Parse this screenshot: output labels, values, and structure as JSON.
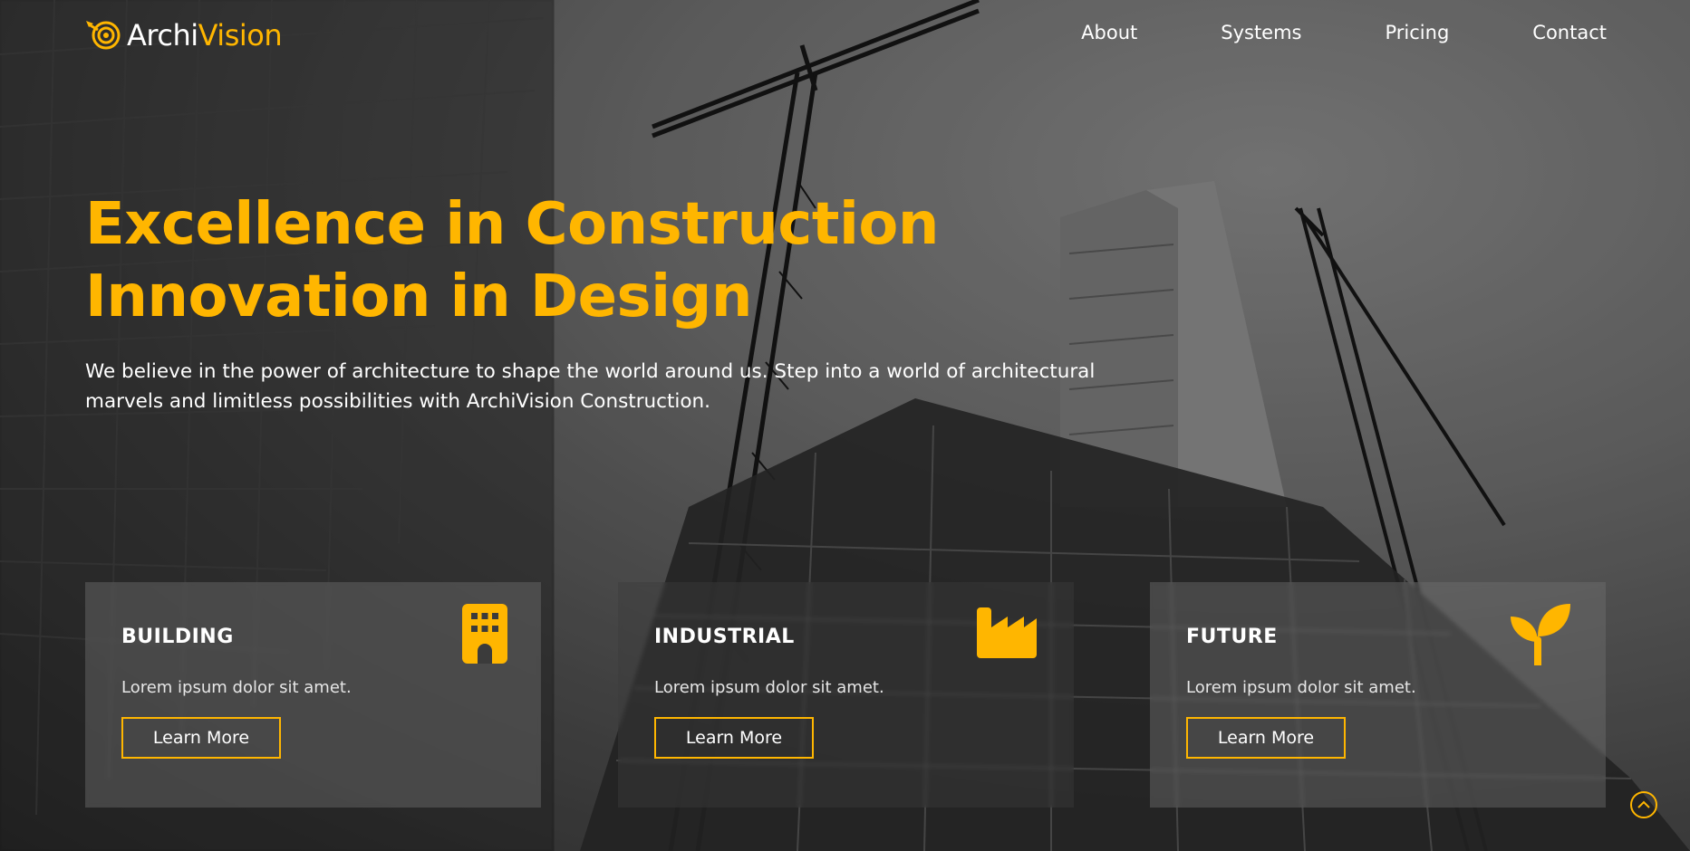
{
  "brand": {
    "part1": "Archi",
    "part2": "Vision",
    "accent": "#ffb600"
  },
  "nav": {
    "items": [
      "About",
      "Systems",
      "Pricing",
      "Contact"
    ]
  },
  "hero": {
    "line1": "Excellence in Construction",
    "line2": "Innovation in Design",
    "lead": "We believe in the power of architecture to shape the world around us. Step into a world of architectural marvels and limitless possibilities with ArchiVision Construction."
  },
  "cards": [
    {
      "title": "BUILDING",
      "text": "Lorem ipsum dolor sit amet.",
      "button": "Learn More",
      "icon": "building-icon"
    },
    {
      "title": "INDUSTRIAL",
      "text": "Lorem ipsum dolor sit amet.",
      "button": "Learn More",
      "icon": "factory-icon"
    },
    {
      "title": "FUTURE",
      "text": "Lorem ipsum dolor sit amet.",
      "button": "Learn More",
      "icon": "sprout-icon"
    }
  ],
  "scroll_top": {
    "icon": "chevron-up-icon"
  }
}
